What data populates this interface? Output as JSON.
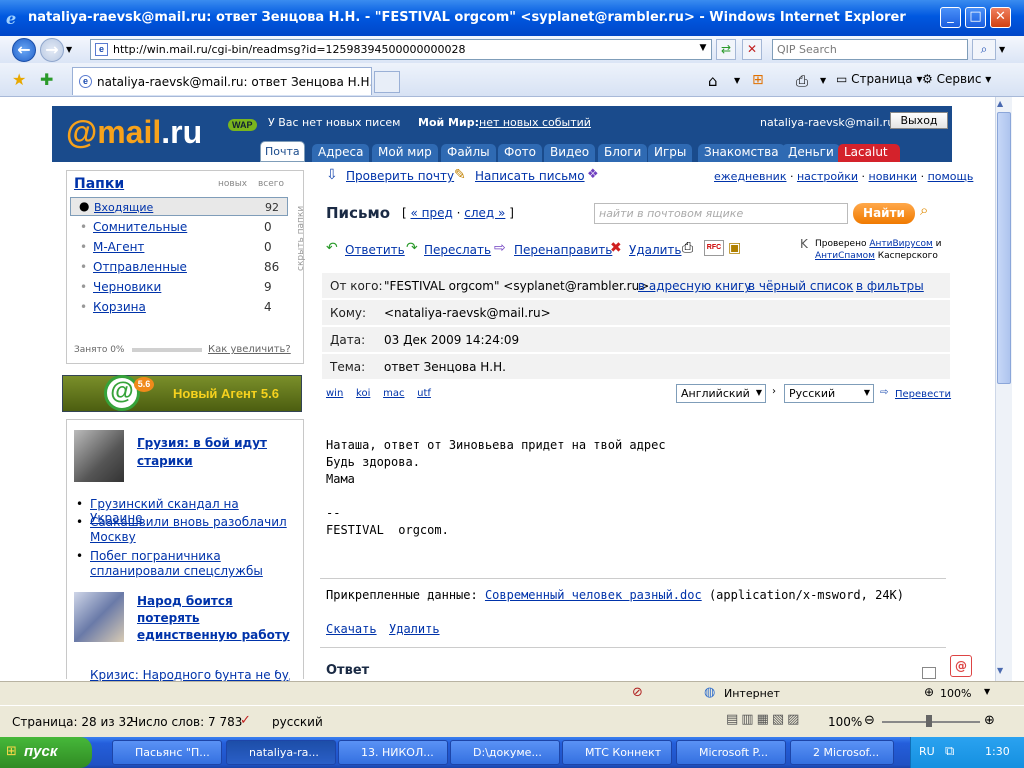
{
  "window": {
    "title": "nataliya-raevsk@mail.ru: ответ Зенцова Н.Н. - \"FESTIVAL orgcom\" <syplanet@rambler.ru> - Windows Internet Explorer"
  },
  "browser": {
    "url": "http://win.mail.ru/cgi-bin/readmsg?id=12598394500000000028",
    "search_placeholder": "QIP Search",
    "tab_title": "nataliya-raevsk@mail.ru: ответ Зенцова Н.Н. - \"FES...",
    "commands": {
      "page": "Страница",
      "service": "Сервис"
    }
  },
  "mailru": {
    "logo_at": "@mail",
    "logo_ru": ".ru",
    "wap": "WAP",
    "no_new_letters": "У Вас нет новых писем",
    "moi_mir_label": "Мой Мир:",
    "no_new_events": "нет новых событий",
    "user": "nataliya-raevsk@mail.ru",
    "logout": "Выход",
    "tabs": [
      "Почта",
      "Адреса",
      "Мой мир",
      "Файлы",
      "Фото",
      "Видео",
      "Блоги",
      "Игры",
      "Знакомства",
      "Деньги",
      "Lacalut"
    ]
  },
  "sidebar": {
    "folders_title": "Папки",
    "col_new": "новых",
    "col_total": "всего",
    "hide_label": "скрыть папки",
    "folders": [
      {
        "name": "Входящие",
        "count": "92"
      },
      {
        "name": "Сомнительные",
        "count": "0"
      },
      {
        "name": "М-Агент",
        "count": "0"
      },
      {
        "name": "Отправленные",
        "count": "86"
      },
      {
        "name": "Черновики",
        "count": "9"
      },
      {
        "name": "Корзина",
        "count": "4"
      }
    ],
    "used": "Занято 0%",
    "how_increase": "Как увеличить?",
    "agent_banner": "Новый Агент 5.6",
    "agent_version": "5.6",
    "news_headline": "Грузия: в бой идут старики",
    "news_items": [
      "Грузинский скандал на Украине",
      "Саакашвили вновь разоблачил Москву",
      "Побег пограничника спланировали спецслужбы"
    ],
    "news2_headline": "Народ боится потерять единственную работу",
    "news_cut": "Кризис: Народного бунта не будет"
  },
  "main": {
    "check_mail": "Проверить почту",
    "write_letter": "Написать письмо",
    "top_links": [
      "ежедневник",
      "настройки",
      "новинки",
      "помощь"
    ],
    "title": "Письмо",
    "prev": "« пред",
    "next": "след »",
    "search_placeholder": "найти в почтовом ящике",
    "find": "Найти",
    "actions": [
      "Ответить",
      "Переслать",
      "Перенаправить",
      "Удалить"
    ],
    "rfc": "RFC",
    "checked": "Проверено",
    "antivirus": "АнтиВирусом",
    "and": "и",
    "antispam": "АнтиСпамом",
    "kaspersky": "Касперского",
    "from_label": "От кого:",
    "from_value": "\"FESTIVAL orgcom\" <syplanet@rambler.ru>",
    "from_links": [
      "в адресную книгу",
      "в чёрный список",
      "в фильтры"
    ],
    "to_label": "Кому:",
    "to_value": "<nataliya-raevsk@mail.ru>",
    "date_label": "Дата:",
    "date_value": "03 Дек 2009 14:24:09",
    "subject_label": "Тема:",
    "subject_value": "ответ Зенцова Н.Н.",
    "encodings": [
      "win",
      "koi",
      "mac",
      "utf"
    ],
    "lang_from": "Английский",
    "lang_to": "Русский",
    "translate": "Перевести",
    "body_lines": [
      "Наташа, ответ от Зиновьева придет на твой адрес",
      "Будь здорова.",
      "Мама",
      "",
      "--",
      "FESTIVAL  orgcom."
    ],
    "attach_label": "Прикрепленные данные:",
    "attach_file": "Современный человек разный.doc",
    "attach_meta": "(application/x-msword, 24K)",
    "download": "Скачать",
    "delete": "Удалить",
    "reply_title": "Ответ"
  },
  "statusbar": {
    "zone": "Интернет",
    "zoom": "100%"
  },
  "word": {
    "page": "Страница: 28 из 32",
    "words": "Число слов: 7 783",
    "lang": "русский",
    "zoom": "100%"
  },
  "taskbar": {
    "start": "пуск",
    "tasks": [
      "Пасьянс \"П...",
      "nataliya-ra...",
      "13. НИКОЛ...",
      "D:\\докуме...",
      "МТС Коннект",
      "Microsoft P...",
      "2 Microsof..."
    ],
    "lang": "RU",
    "time": "1:30"
  }
}
